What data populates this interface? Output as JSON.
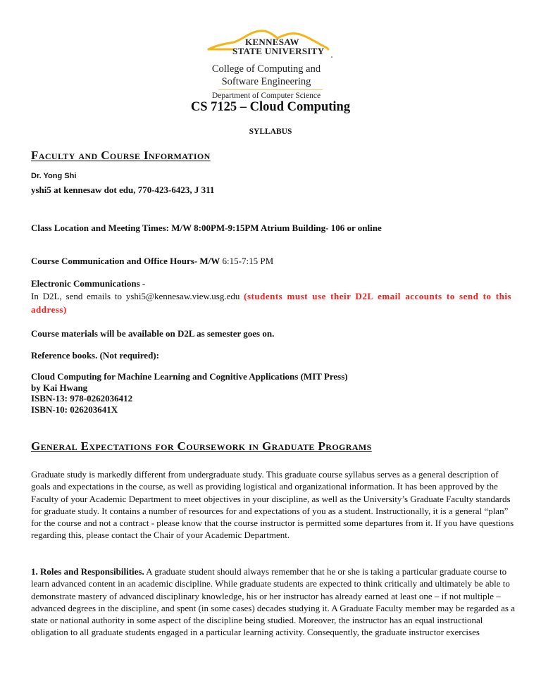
{
  "header": {
    "logo": {
      "university_line1": "KENNESAW",
      "university_line2": "STATE UNIVERSITY",
      "college_line1": "College of Computing and",
      "college_line2": "Software Engineering",
      "department": "Department of Computer Science",
      "colors": {
        "gold": "#f2b619",
        "text": "#222222"
      }
    },
    "course_title": "CS 7125 – Cloud Computing",
    "doc_type": "SYLLABUS"
  },
  "faculty_section": {
    "heading": "Faculty and Course Information",
    "instructor_name": "Dr. Yong Shi",
    "contact": "yshi5 at kennesaw dot edu, 770-423-6423, J 311",
    "class_location": "Class Location and Meeting Times: M/W 8:00PM-9:15PM Atrium Building- 106 or online",
    "office_hours_label": "Course Communication and Office Hours- M/W",
    "office_hours_value": " 6:15-7:15  PM",
    "electronic_heading": "Electronic Communications -",
    "electronic_body": "In D2L, send emails to yshi5@kennesaw.view.usg.edu ",
    "electronic_warning": "(students must use their D2L email accounts to send to this address)",
    "warning_color": "#ff1a1a",
    "materials_note": "Course materials will be available on D2L as semester goes on.",
    "reference_heading": "Reference books. (Not required):",
    "book": {
      "title": "Cloud Computing for Machine Learning and Cognitive Applications (MIT Press)",
      "author": "by Kai Hwang",
      "isbn13": "ISBN-13: 978-0262036412",
      "isbn10": "ISBN-10: 026203641X"
    }
  },
  "expectations_section": {
    "heading": "General Expectations for Coursework in Graduate Programs",
    "intro_paragraph": "Graduate study is markedly different from undergraduate study. This graduate course syllabus serves as a general description of goals and expectations in the course, as well as providing logistical and organizational information. It has been approved by the Faculty of your Academic Department to meet objectives in your discipline, as well as the University’s Graduate Faculty standards for graduate study. It contains a number of resources for and expectations of you as a student. Instructionally, it is a general “plan” for the course and not a contract - please know that the course instructor is permitted some departures from it. If you have questions regarding this, please contact the Chair of your Academic Department.",
    "roles_lead": "1. Roles and Responsibilities.",
    "roles_paragraph": " A graduate student should always remember that he or she is taking a particular graduate course to learn advanced content in an academic discipline. While graduate students are expected to think critically and ultimately be able to demonstrate mastery of advanced disciplinary knowledge, his or her instructor has already earned at least one – if not multiple – advanced degrees in the discipline, and spent (in some cases) decades studying it. A Graduate Faculty member may be regarded as a state or national authority in some aspect of the discipline being studied. Moreover, the instructor has an equal instructional obligation to all graduate students engaged in a particular learning activity. Consequently, the graduate instructor exercises"
  }
}
